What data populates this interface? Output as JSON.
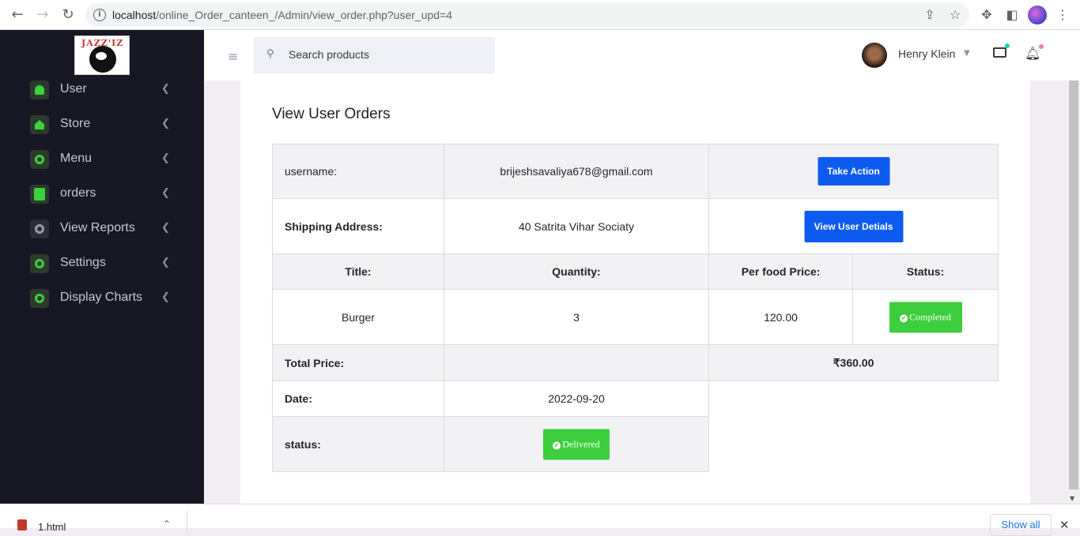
{
  "browser": {
    "url_host": "localhost",
    "url_path": "/online_Order_canteen_/Admin/view_order.php?user_upd=4"
  },
  "sidebar": {
    "logo_text": "JAZZ'IZ",
    "items": [
      {
        "label": "User",
        "icon": "user-icon"
      },
      {
        "label": "Store",
        "icon": "home-icon"
      },
      {
        "label": "Menu",
        "icon": "target-icon"
      },
      {
        "label": "orders",
        "icon": "clipboard-icon"
      },
      {
        "label": "View Reports",
        "icon": "gear-icon"
      },
      {
        "label": "Settings",
        "icon": "gear-icon"
      },
      {
        "label": "Display Charts",
        "icon": "gear-icon"
      }
    ]
  },
  "topbar": {
    "search_placeholder": "Search products",
    "user_name": "Henry Klein"
  },
  "order": {
    "title": "View User Orders",
    "username_label": "username:",
    "username_value": "brijeshsavaliya678@gmail.com",
    "take_action_label": "Take Action",
    "shipping_label": "Shipping Address:",
    "shipping_value": "40 Satrita Vihar Sociaty",
    "view_user_label": "View User Detials",
    "headers": {
      "title": "Title:",
      "quantity": "Quantity:",
      "price": "Per food Price:",
      "status": "Status:"
    },
    "item": {
      "title": "Burger",
      "quantity": "3",
      "price": "120.00",
      "status": "Completed"
    },
    "total_label": "Total Price:",
    "total_value": "₹360.00",
    "date_label": "Date:",
    "date_value": "2022-09-20",
    "status_label": "status:",
    "status_value": "Delivered"
  },
  "downloads": {
    "file_name": "1.html",
    "show_all": "Show all"
  }
}
